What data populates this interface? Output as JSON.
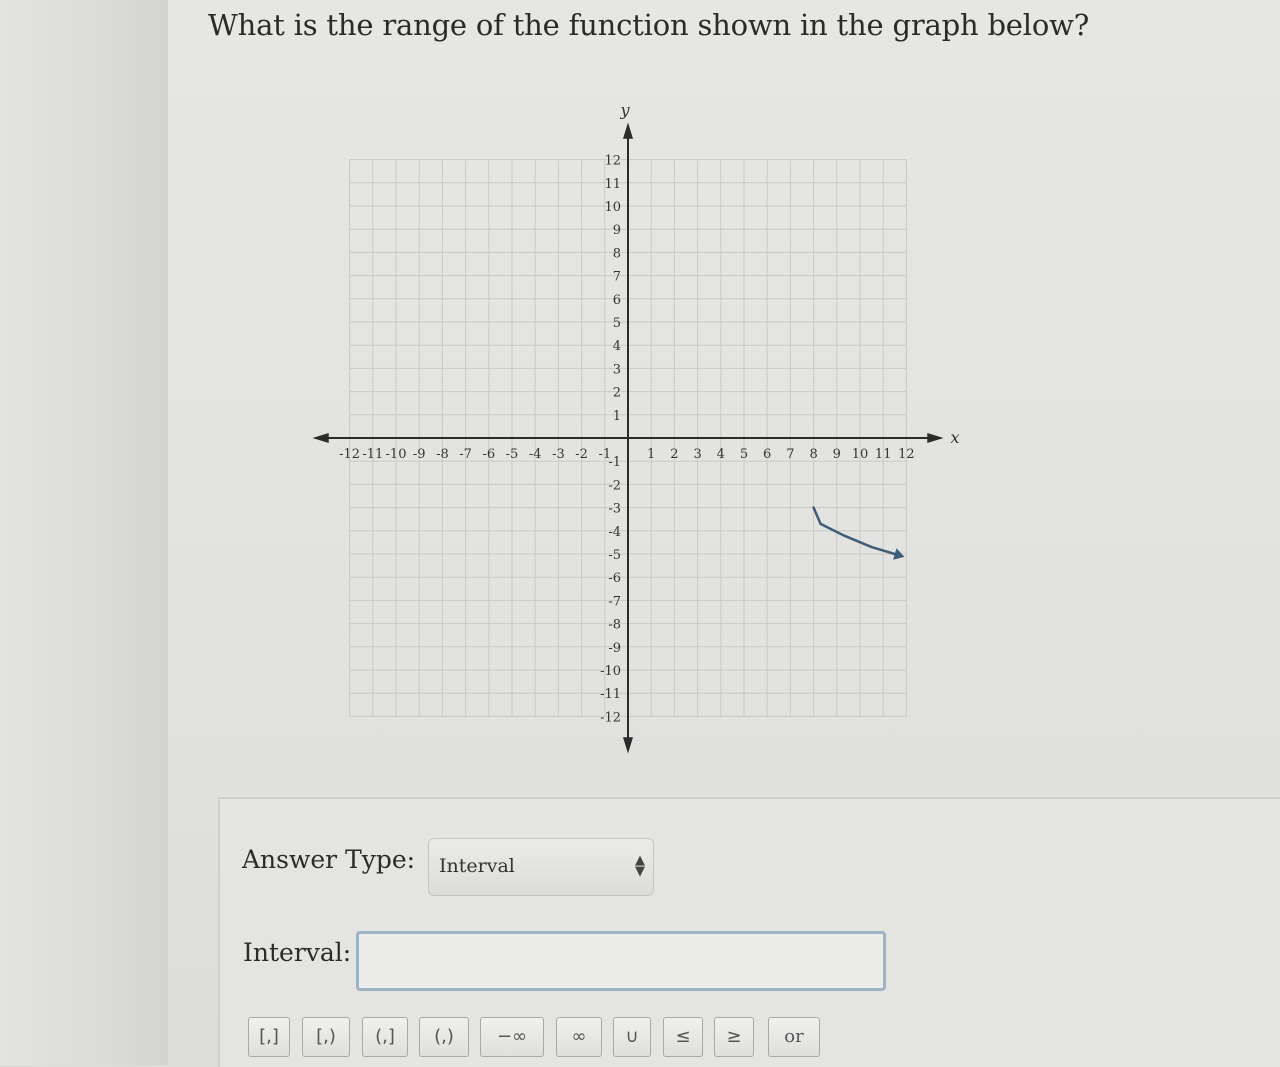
{
  "question": "What is the range of the function shown in the graph below?",
  "chart_data": {
    "type": "line",
    "xlabel": "x",
    "ylabel": "y",
    "xlim": [
      -12,
      12
    ],
    "ylim": [
      -12,
      12
    ],
    "grid": true,
    "x_ticks": [
      "-12",
      "-11",
      "-10",
      "-9",
      "-8",
      "-7",
      "-6",
      "-5",
      "-4",
      "-3",
      "-2",
      "-1",
      "1",
      "2",
      "3",
      "4",
      "5",
      "6",
      "7",
      "8",
      "9",
      "10",
      "11",
      "12"
    ],
    "y_ticks": [
      "12",
      "11",
      "10",
      "9",
      "8",
      "7",
      "6",
      "5",
      "4",
      "3",
      "2",
      "1",
      "-1",
      "-2",
      "-3",
      "-4",
      "-5",
      "-6",
      "-7",
      "-8",
      "-9",
      "-10",
      "-11",
      "-12"
    ],
    "series": [
      {
        "points": [
          [
            8,
            -3
          ],
          [
            8.3,
            -3.7
          ],
          [
            9.3,
            -4.2
          ],
          [
            10.5,
            -4.7
          ],
          [
            11.5,
            -5
          ]
        ],
        "start": "open endpoint at (8, -3)",
        "end": "arrow continuing right and down"
      }
    ],
    "colors": {
      "curve": "#3f5d78",
      "grid": "#c9c9c6",
      "axis": "#2b2b2b"
    }
  },
  "answer": {
    "type_label": "Answer Type:",
    "type_value": "Interval",
    "interval_label": "Interval:",
    "interval_value": ""
  },
  "toolbar": [
    {
      "name": "closed-closed-interval-button",
      "label": "[,]"
    },
    {
      "name": "closed-open-interval-button",
      "label": "[,)"
    },
    {
      "name": "open-closed-interval-button",
      "label": "(,]"
    },
    {
      "name": "open-open-interval-button",
      "label": "(,)"
    },
    {
      "name": "negative-infinity-button",
      "label": "−∞"
    },
    {
      "name": "infinity-button",
      "label": "∞"
    },
    {
      "name": "union-button",
      "label": "∪"
    },
    {
      "name": "less-equal-button",
      "label": "≤"
    },
    {
      "name": "greater-equal-button",
      "label": "≥"
    },
    {
      "name": "or-button",
      "label": "or"
    }
  ]
}
